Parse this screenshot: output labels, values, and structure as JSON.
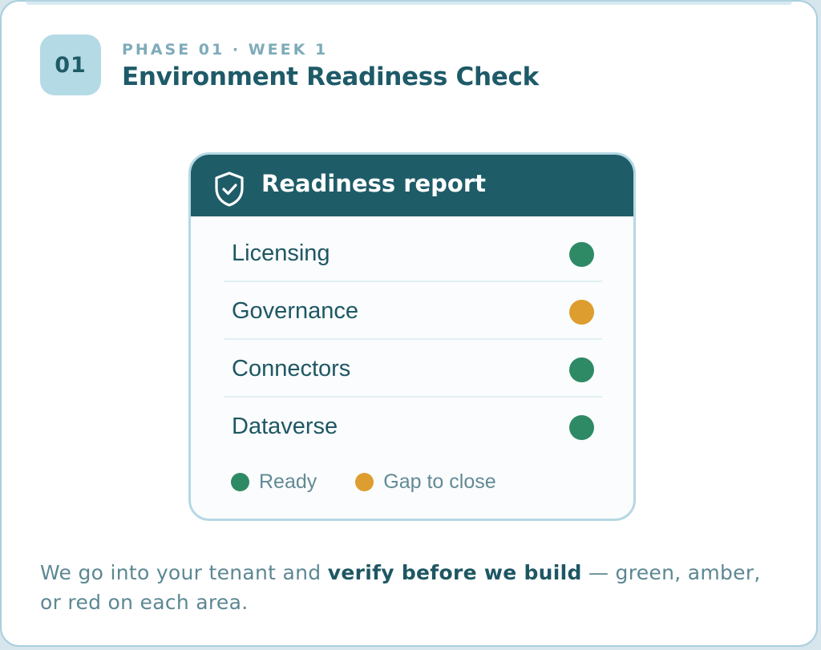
{
  "header": {
    "phase_number": "01",
    "eyebrow": "PHASE 01 · WEEK 1",
    "title": "Environment Readiness Check"
  },
  "report": {
    "title": "Readiness report",
    "icon": "shield-check-icon",
    "rows": [
      {
        "label": "Licensing",
        "status": "ready",
        "color": "#2e8a65"
      },
      {
        "label": "Governance",
        "status": "gap",
        "color": "#dd9d2f"
      },
      {
        "label": "Connectors",
        "status": "ready",
        "color": "#2e8a65"
      },
      {
        "label": "Dataverse",
        "status": "ready",
        "color": "#2e8a65"
      }
    ],
    "legend": [
      {
        "label": "Ready",
        "color": "#2e8a65"
      },
      {
        "label": "Gap to close",
        "color": "#dd9d2f"
      }
    ]
  },
  "caption": {
    "before": "We go into your tenant and ",
    "bold": "verify before we build",
    "after": " — green, amber, or red on each area."
  },
  "colors": {
    "header_bg": "#1e5c68",
    "ready": "#2e8a65",
    "gap": "#dd9d2f",
    "accent_light": "#b4dae6"
  }
}
